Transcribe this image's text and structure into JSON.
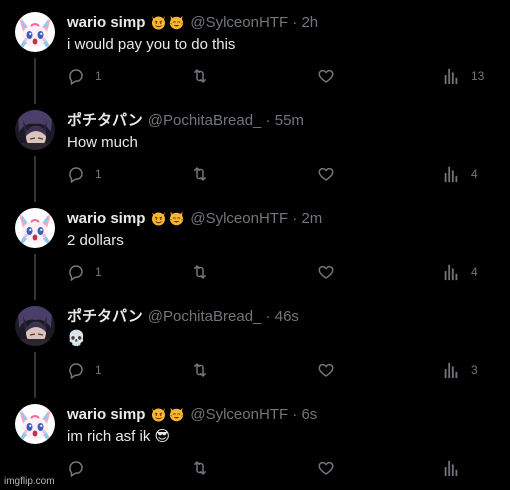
{
  "colors": {
    "background": "#000000",
    "text": "#e7e9ea",
    "muted": "#71767b",
    "thread_line": "#333639"
  },
  "tweets": [
    {
      "name": "wario simp",
      "badges": [
        "smiling-imp-emoji",
        "smiling-cat-emoji"
      ],
      "handle_time": "@SylceonHTF · 2h",
      "text": "i would pay you to do this",
      "replies": "1",
      "views": "13",
      "avatar": "sylceon-avatar"
    },
    {
      "name": "ポチタパン",
      "badges": [],
      "handle_time": "@PochitaBread_ · 55m",
      "text": "How much",
      "replies": "1",
      "views": "4",
      "avatar": "dark-haired-avatar"
    },
    {
      "name": "wario simp",
      "badges": [
        "smiling-imp-emoji",
        "smiling-cat-emoji"
      ],
      "handle_time": "@SylceonHTF · 2m",
      "text": "2 dollars",
      "replies": "1",
      "views": "4",
      "avatar": "sylceon-avatar"
    },
    {
      "name": "ポチタパン",
      "badges": [],
      "handle_time": "@PochitaBread_ · 46s",
      "text": "💀",
      "replies": "1",
      "views": "3",
      "avatar": "dark-haired-avatar"
    },
    {
      "name": "wario simp",
      "badges": [
        "smiling-imp-emoji",
        "smiling-cat-emoji"
      ],
      "handle_time": "@SylceonHTF · 6s",
      "text": "im rich asf ik 😎",
      "replies": "",
      "views": "",
      "avatar": "sylceon-avatar"
    }
  ],
  "watermark": "imgflip.com"
}
